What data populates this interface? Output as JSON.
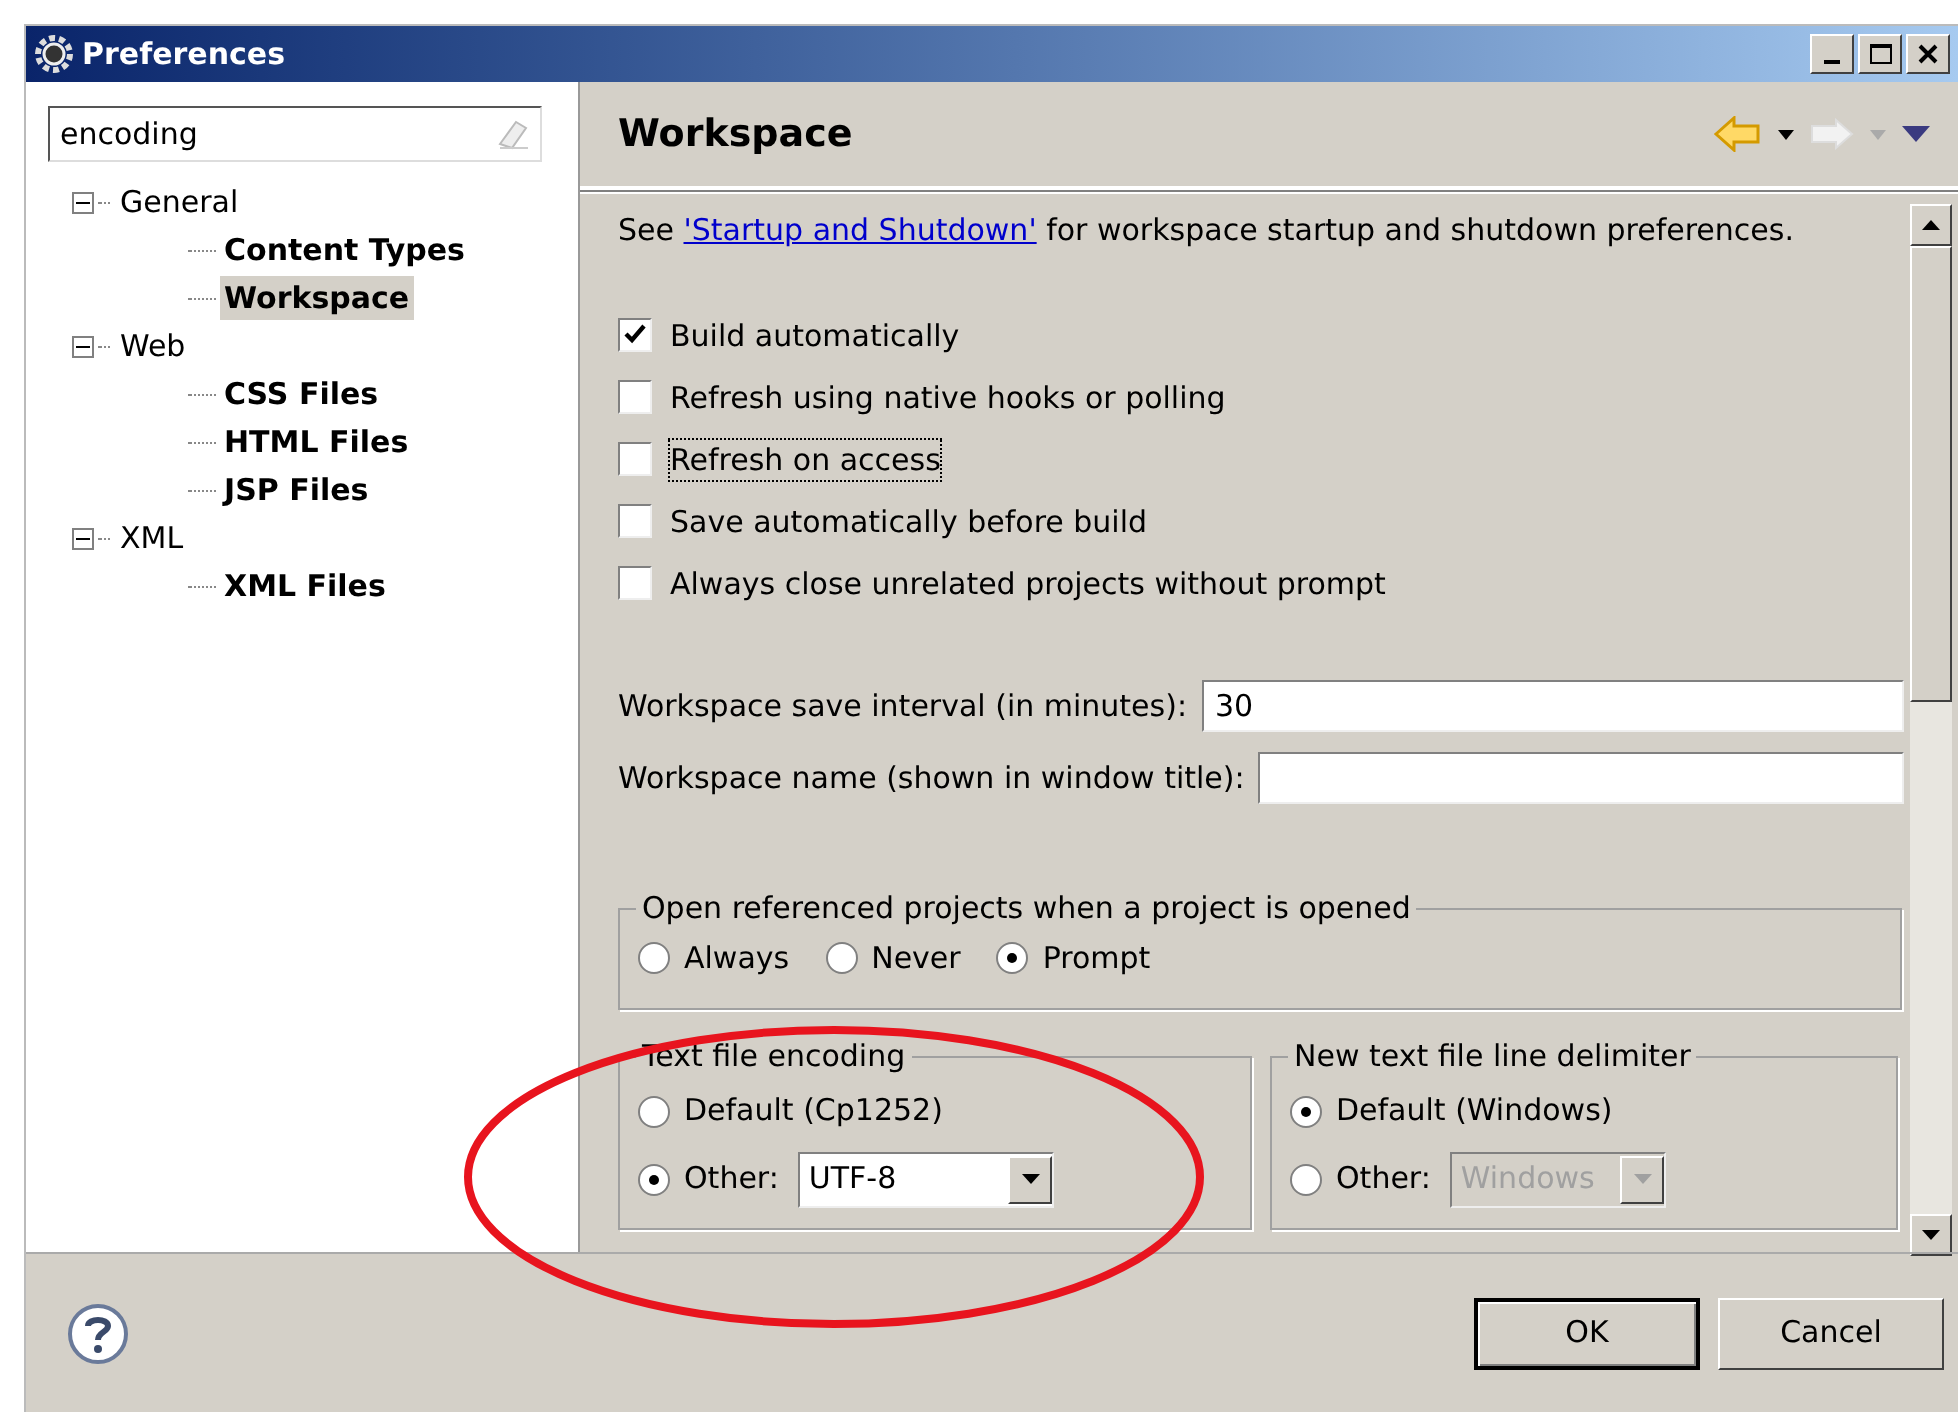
{
  "window": {
    "title": "Preferences"
  },
  "filter": {
    "value": "encoding"
  },
  "tree": [
    {
      "label": "General",
      "bold": false,
      "selected": false,
      "expanded": true,
      "children": [
        {
          "label": "Content Types",
          "bold": true,
          "selected": false
        },
        {
          "label": "Workspace",
          "bold": true,
          "selected": true
        }
      ]
    },
    {
      "label": "Web",
      "bold": false,
      "selected": false,
      "expanded": true,
      "children": [
        {
          "label": "CSS Files",
          "bold": true,
          "selected": false
        },
        {
          "label": "HTML Files",
          "bold": true,
          "selected": false
        },
        {
          "label": "JSP Files",
          "bold": true,
          "selected": false
        }
      ]
    },
    {
      "label": "XML",
      "bold": false,
      "selected": false,
      "expanded": true,
      "children": [
        {
          "label": "XML Files",
          "bold": true,
          "selected": false
        }
      ]
    }
  ],
  "page": {
    "title": "Workspace",
    "intro": {
      "before": "See ",
      "link": "'Startup and Shutdown'",
      "after": " for workspace startup and shutdown preferences."
    },
    "checkboxes": [
      {
        "label": "Build automatically",
        "checked": true,
        "focused": false
      },
      {
        "label": "Refresh using native hooks or polling",
        "checked": false,
        "focused": false
      },
      {
        "label": "Refresh on access",
        "checked": false,
        "focused": true
      },
      {
        "label": "Save automatically before build",
        "checked": false,
        "focused": false
      },
      {
        "label": "Always close unrelated projects without prompt",
        "checked": false,
        "focused": false
      }
    ],
    "fields": [
      {
        "label": "Workspace save interval (in minutes):",
        "value": "30"
      },
      {
        "label": "Workspace name (shown in window title):"
      }
    ],
    "open_projects": {
      "title": "Open referenced projects when a project is opened",
      "options": [
        {
          "label": "Always",
          "selected": false
        },
        {
          "label": "Never",
          "selected": false
        },
        {
          "label": "Prompt",
          "selected": true
        }
      ]
    },
    "encoding": {
      "title": "Text file encoding",
      "options": [
        {
          "label": "Default (Cp1252)",
          "selected": false
        },
        {
          "label": "Other:",
          "selected": true
        }
      ],
      "combo": {
        "value": "UTF-8",
        "disabled": false
      }
    },
    "delimiter": {
      "title": "New text file line delimiter",
      "options": [
        {
          "label": "Default (Windows)",
          "selected": true
        },
        {
          "label": "Other:",
          "selected": false
        }
      ],
      "combo": {
        "value": "Windows",
        "disabled": true
      }
    }
  },
  "buttons": [
    {
      "label": "OK",
      "kind": "default"
    },
    {
      "label": "Cancel",
      "kind": "normal"
    }
  ]
}
